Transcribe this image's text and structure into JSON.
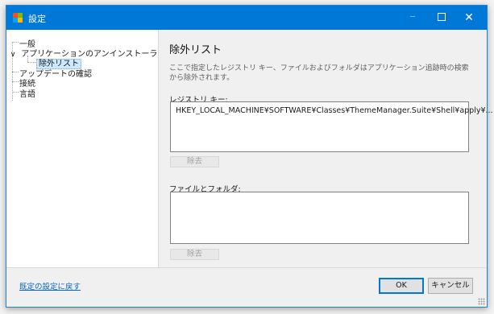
{
  "window": {
    "title": "設定",
    "close_glyph": "✕",
    "minimize_glyph": "─"
  },
  "tree": {
    "items": [
      {
        "label": "一般"
      },
      {
        "label": "アプリケーションのアンインストーラ",
        "expander": "∨"
      },
      {
        "label": "除外リスト",
        "selected": true
      },
      {
        "label": "アップデートの確認"
      },
      {
        "label": "接続"
      },
      {
        "label": "言語"
      }
    ]
  },
  "content": {
    "title": "除外リスト",
    "description": "ここで指定したレジストリ キー、ファイルおよびフォルダはアプリケーション追跡時の検索から除外されます。",
    "registry": {
      "label": "レジストリ キー:",
      "items": [
        "HKEY_LOCAL_MACHINE¥SOFTWARE¥Classes¥ThemeManager.Suite¥Shell¥apply¥..."
      ],
      "remove_label": "除去"
    },
    "files": {
      "label": "ファイルとフォルダ:",
      "items": [],
      "remove_label": "除去"
    }
  },
  "footer": {
    "reset_link": "既定の設定に戻す",
    "ok_label": "OK",
    "cancel_label": "キャンセル"
  },
  "colors": {
    "titlebar": "#0078d7",
    "selection": "#cce8ff",
    "link": "#0066cc"
  }
}
